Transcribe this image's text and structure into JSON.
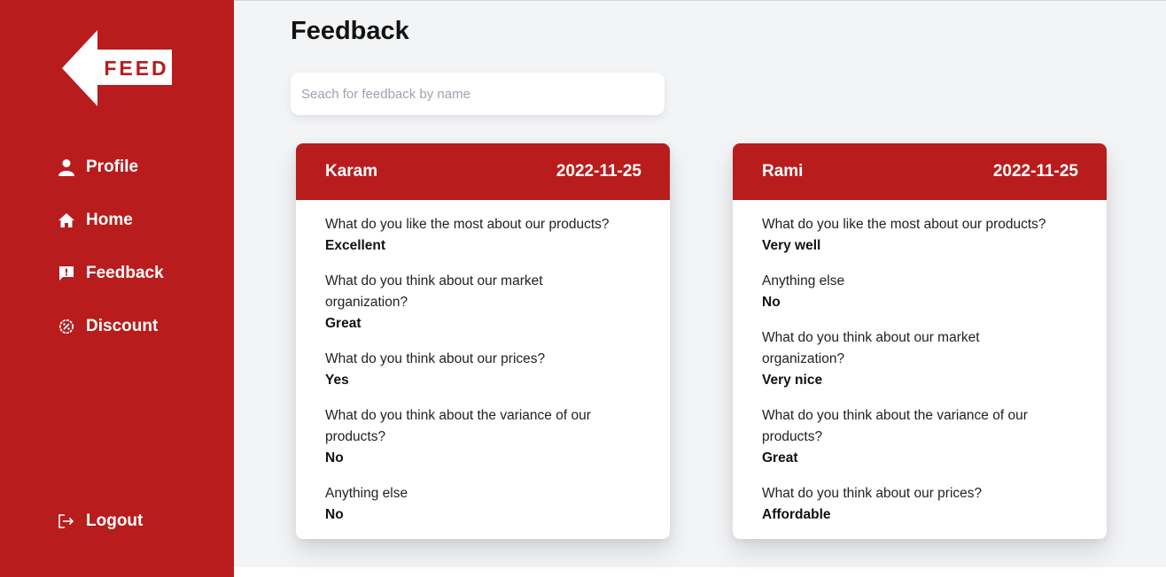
{
  "logo": {
    "text": "FEED"
  },
  "nav": {
    "items": [
      {
        "label": "Profile",
        "icon": "user-icon"
      },
      {
        "label": "Home",
        "icon": "home-icon"
      },
      {
        "label": "Feedback",
        "icon": "feedback-icon"
      },
      {
        "label": "Discount",
        "icon": "discount-icon"
      }
    ],
    "logout": {
      "label": "Logout",
      "icon": "logout-icon"
    }
  },
  "page": {
    "title": "Feedback",
    "search": {
      "placeholder": "Seach for feedback by name",
      "value": ""
    }
  },
  "cards": [
    {
      "name": "Karam",
      "date": "2022-11-25",
      "items": [
        {
          "q": "What do you like the most about our products?",
          "a": "Excellent"
        },
        {
          "q": "What do you think about our market organization?",
          "a": "Great"
        },
        {
          "q": "What do you think about our prices?",
          "a": "Yes"
        },
        {
          "q": "What do you think about the variance of our products?",
          "a": "No"
        },
        {
          "q": "Anything else",
          "a": "No"
        }
      ]
    },
    {
      "name": "Rami",
      "date": "2022-11-25",
      "items": [
        {
          "q": "What do you like the most about our products?",
          "a": "Very well"
        },
        {
          "q": "Anything else",
          "a": "No"
        },
        {
          "q": "What do you think about our market organization?",
          "a": "Very nice"
        },
        {
          "q": "What do you think about the variance of our products?",
          "a": "Great"
        },
        {
          "q": "What do you think about our prices?",
          "a": "Affordable"
        }
      ]
    }
  ],
  "colors": {
    "brand": "#b91c1c",
    "background": "#f3f4f6",
    "card": "#ffffff"
  }
}
